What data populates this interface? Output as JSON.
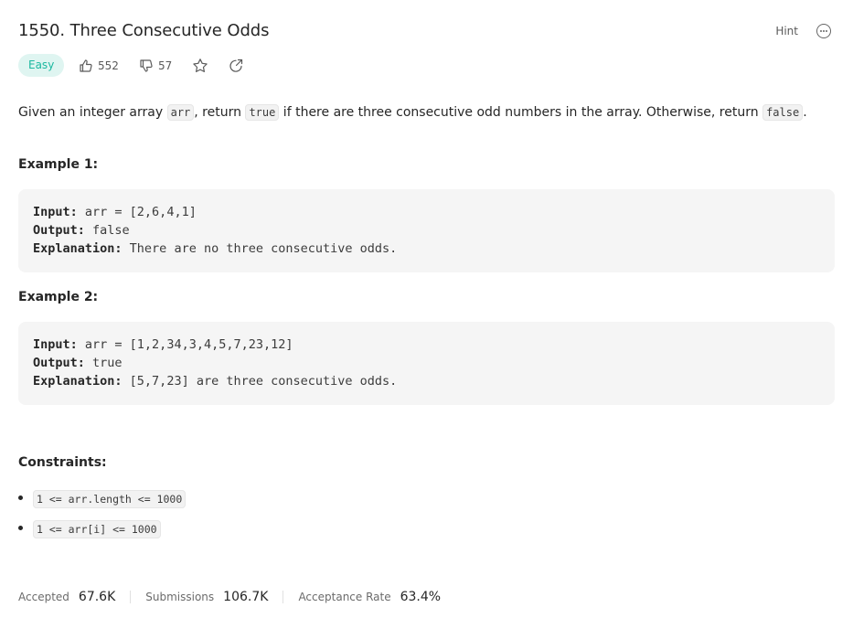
{
  "problem": {
    "title": "1550. Three Consecutive Odds",
    "hint_label": "Hint",
    "difficulty": "Easy",
    "likes": "552",
    "dislikes": "57"
  },
  "description": {
    "p1": "Given an integer array ",
    "c1": "arr",
    "p2": ", return ",
    "c2": "true",
    "p3": " if there are three consecutive odd numbers in the array. Otherwise, return ",
    "c3": "false",
    "p4": "."
  },
  "examples": [
    {
      "title": "Example 1:",
      "input_key": "Input:",
      "input_val": " arr = [2,6,4,1]",
      "output_key": "Output:",
      "output_val": " false",
      "expl_key": "Explanation:",
      "expl_val": " There are no three consecutive odds."
    },
    {
      "title": "Example 2:",
      "input_key": "Input:",
      "input_val": " arr = [1,2,34,3,4,5,7,23,12]",
      "output_key": "Output:",
      "output_val": " true",
      "expl_key": "Explanation:",
      "expl_val": " [5,7,23] are three consecutive odds."
    }
  ],
  "constraints": {
    "title": "Constraints:",
    "items": [
      "1 <= arr.length <= 1000",
      "1 <= arr[i] <= 1000"
    ]
  },
  "stats": {
    "accepted_label": "Accepted",
    "accepted_value": "67.6K",
    "submissions_label": "Submissions",
    "submissions_value": "106.7K",
    "rate_label": "Acceptance Rate",
    "rate_value": "63.4%"
  },
  "icons": {
    "like": "thumbs-up-icon",
    "dislike": "thumbs-down-icon",
    "favorite": "star-icon",
    "share": "share-icon",
    "more": "more-options-icon"
  },
  "colors": {
    "easy_text": "#1cb8a0",
    "easy_bg": "#dff5f1"
  }
}
